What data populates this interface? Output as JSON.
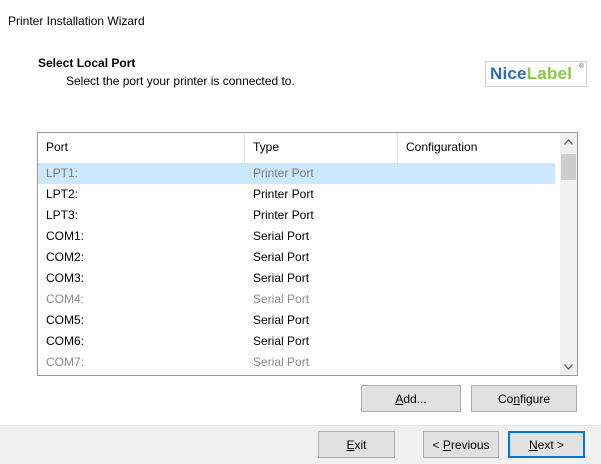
{
  "window": {
    "title": "Printer Installation Wizard"
  },
  "header": {
    "heading": "Select Local Port",
    "subheading": "Select the port your printer is connected to.",
    "logo": {
      "part1": "Nice",
      "part2": "Label",
      "trademark": "®"
    }
  },
  "table": {
    "columns": [
      "Port",
      "Type",
      "Configuration"
    ],
    "rows": [
      {
        "port": "LPT1:",
        "type": "Printer Port",
        "configuration": ""
      },
      {
        "port": "LPT2:",
        "type": "Printer Port",
        "configuration": ""
      },
      {
        "port": "LPT3:",
        "type": "Printer Port",
        "configuration": ""
      },
      {
        "port": "COM1:",
        "type": "Serial Port",
        "configuration": ""
      },
      {
        "port": "COM2:",
        "type": "Serial Port",
        "configuration": ""
      },
      {
        "port": "COM3:",
        "type": "Serial Port",
        "configuration": ""
      },
      {
        "port": "COM4:",
        "type": "Serial Port",
        "configuration": ""
      },
      {
        "port": "COM5:",
        "type": "Serial Port",
        "configuration": ""
      },
      {
        "port": "COM6:",
        "type": "Serial Port",
        "configuration": ""
      },
      {
        "port": "COM7:",
        "type": "Serial Port",
        "configuration": ""
      }
    ]
  },
  "buttons": {
    "add": {
      "mnemonic": "A",
      "rest": "dd..."
    },
    "configure": {
      "pre": "Co",
      "mnemonic": "n",
      "rest": "figure"
    },
    "exit": {
      "mnemonic": "E",
      "rest": "xit"
    },
    "previous": {
      "pre": "< ",
      "mnemonic": "P",
      "rest": "revious"
    },
    "next": {
      "mnemonic": "N",
      "rest": "ext >"
    }
  },
  "colors": {
    "selection": "#cce8ff",
    "default_button_border": "#0078d7",
    "logo_blue": "#2a6fb3",
    "logo_green": "#8dc63f"
  },
  "icons": {
    "scroll_up": "chevron-up-icon",
    "scroll_down": "chevron-down-icon"
  }
}
